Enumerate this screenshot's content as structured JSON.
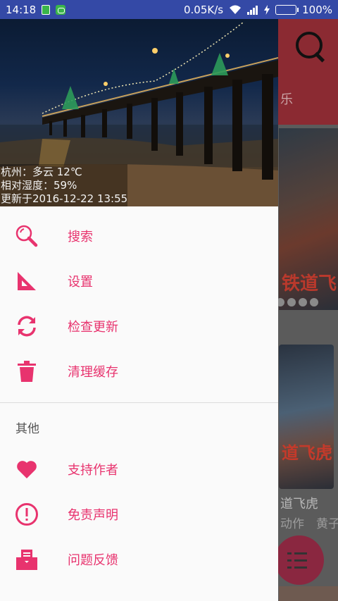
{
  "status_bar": {
    "time": "14:18",
    "speed": "0.05K/s",
    "battery": "100%",
    "battery_level": 100
  },
  "background": {
    "tab_text": "乐",
    "poster_text": "铁道飞",
    "poster2_text": "道飞虎",
    "movie_title": "道飞虎",
    "movie_sub": "动作　黄子韬"
  },
  "header": {
    "weather_line1": "杭州：多云  12℃",
    "weather_line2": "相对湿度：59%",
    "weather_line3": "更新于2016-12-22 13:55"
  },
  "menu": {
    "items": [
      {
        "label": "搜索",
        "icon": "search-icon"
      },
      {
        "label": "设置",
        "icon": "set-square-icon"
      },
      {
        "label": "检查更新",
        "icon": "refresh-icon"
      },
      {
        "label": "清理缓存",
        "icon": "trash-icon"
      }
    ],
    "section_title": "其他",
    "other_items": [
      {
        "label": "支持作者",
        "icon": "heart-icon"
      },
      {
        "label": "免责声明",
        "icon": "alert-icon"
      },
      {
        "label": "问题反馈",
        "icon": "feedback-icon"
      }
    ]
  },
  "colors": {
    "accent": "#e8336e",
    "status_bar": "#3449a6"
  }
}
